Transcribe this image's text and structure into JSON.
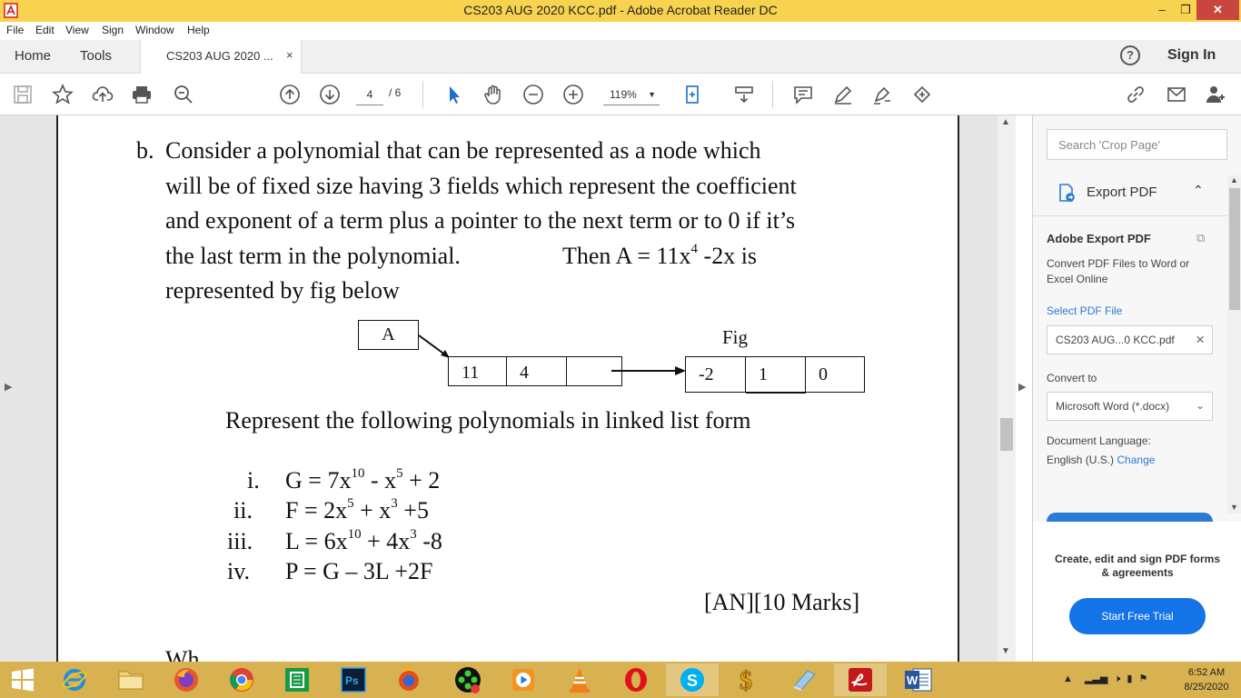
{
  "window": {
    "title": "CS203 AUG 2020 KCC.pdf - Adobe Acrobat Reader DC",
    "min": "–",
    "max": "❐",
    "close": "✕"
  },
  "menu": [
    "File",
    "Edit",
    "View",
    "Sign",
    "Window",
    "Help"
  ],
  "tabs": {
    "home": "Home",
    "tools": "Tools",
    "doc": "CS203 AUG 2020 ...",
    "close": "×",
    "sign_in": "Sign In"
  },
  "toolbar": {
    "page_current": "4",
    "page_total": "/ 6",
    "zoom": "119%"
  },
  "document": {
    "q_label": "b.",
    "lines": [
      "Consider a polynomial that can be represented as a node  which",
      "will be of fixed size having 3 fields which represent the coefficient",
      "and exponent of a term plus a pointer to the next term or to 0 if it’s"
    ],
    "line4a": "the last term in the polynomial.",
    "line4b_pre": "Then A = 11x",
    "line4b_exp": "4",
    "line4b_post": "  -2x  is",
    "line5": "represented by fig below",
    "fig": {
      "head": "A",
      "label": "Fig",
      "node1": [
        "11",
        "4",
        ""
      ],
      "node2": [
        "-2",
        "1",
        "0"
      ]
    },
    "represent": "Represent the following polynomials in linked list form",
    "items": [
      {
        "num": "i.",
        "parts": [
          "G = 7x",
          "10",
          " -  x",
          "5",
          " + 2"
        ]
      },
      {
        "num": "ii.",
        "parts": [
          "F = 2x",
          "5",
          " + x",
          "3",
          "  +5"
        ]
      },
      {
        "num": "iii.",
        "parts": [
          "L = 6x",
          "10",
          "  + 4x",
          "3",
          "  -8"
        ]
      },
      {
        "num": "iv.",
        "parts": [
          "P = G – 3L +2F"
        ]
      }
    ],
    "marks": "[AN][10 Marks]"
  },
  "right_panel": {
    "search_placeholder": "Search 'Crop Page'",
    "export_pdf": "Export PDF",
    "adobe_export": "Adobe Export PDF",
    "description": "Convert PDF Files to Word or Excel Online",
    "select_file": "Select PDF File",
    "file_name": "CS203 AUG...0 KCC.pdf",
    "convert_to": "Convert to",
    "format": "Microsoft Word (*.docx)",
    "doc_lang_label": "Document Language:",
    "doc_lang": "English (U.S.)",
    "change": "Change",
    "promo": "Create, edit and sign PDF forms & agreements",
    "trial": "Start Free Trial"
  },
  "taskbar": {
    "time": "6:52 AM",
    "date": "8/25/2020"
  },
  "colors": {
    "titlebar": "#f8d34f",
    "taskbar": "#d8b150",
    "accent": "#1473e6",
    "close": "#c7463d"
  }
}
